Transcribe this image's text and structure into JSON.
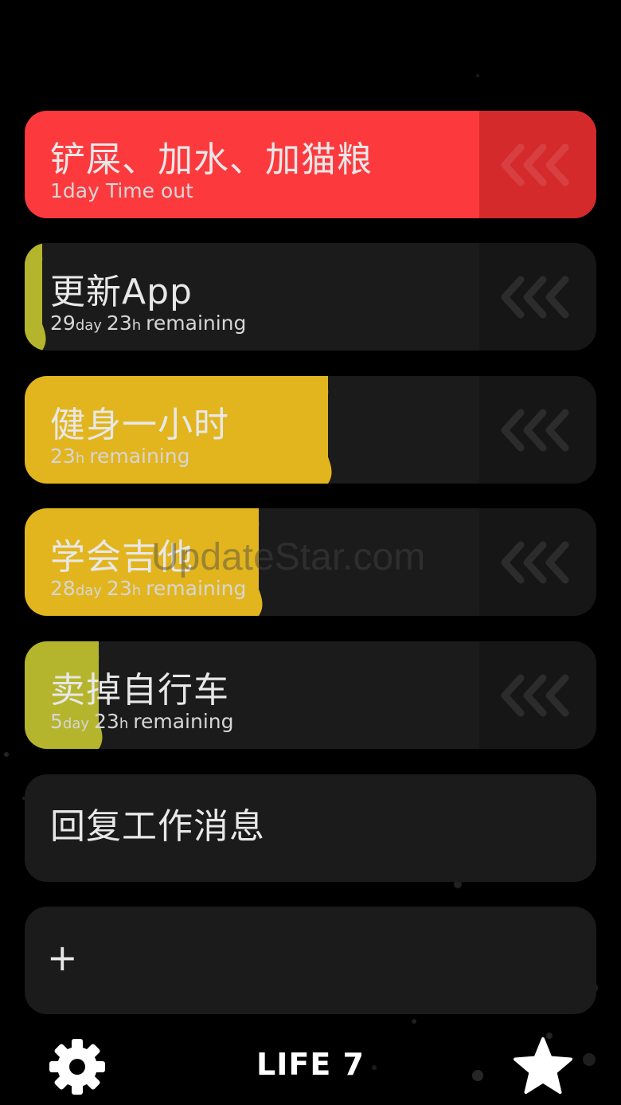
{
  "tasks": [
    {
      "title": "铲屎、加水、加猫粮",
      "sub_text": "1day Time out",
      "progress": 1.0,
      "fill_color": "#fc3a3e",
      "status": "timeout"
    },
    {
      "title": "更新App",
      "days": "29",
      "day_unit": "day",
      "hours": "23",
      "hour_unit": "h",
      "remaining_label": "remaining",
      "progress": 0.03,
      "fill_color": "#b4b52d"
    },
    {
      "title": "健身一小时",
      "hours": "23",
      "hour_unit": "h",
      "remaining_label": "remaining",
      "progress": 0.53,
      "fill_color": "#e2b51e"
    },
    {
      "title": "学会吉他",
      "days": "28",
      "day_unit": "day",
      "hours": "23",
      "hour_unit": "h",
      "remaining_label": "remaining",
      "progress": 0.41,
      "fill_color": "#e2b51e"
    },
    {
      "title": "卖掉自行车",
      "days": "5",
      "day_unit": "day",
      "hours": "23",
      "hour_unit": "h",
      "remaining_label": "remaining",
      "progress": 0.13,
      "fill_color": "#b4b52d"
    },
    {
      "title": "回复工作消息"
    }
  ],
  "add_card": {
    "label": "+"
  },
  "watermark": "UpdateStar.com",
  "footer": {
    "brand": "LIFE 7",
    "settings_icon": "gear-icon",
    "favorites_icon": "star-icon"
  },
  "colors": {
    "background": "#000000",
    "card": "#1b1b1b",
    "timeout_red": "#fc3a3e",
    "yellow": "#e2b51e",
    "olive": "#b4b52d"
  }
}
